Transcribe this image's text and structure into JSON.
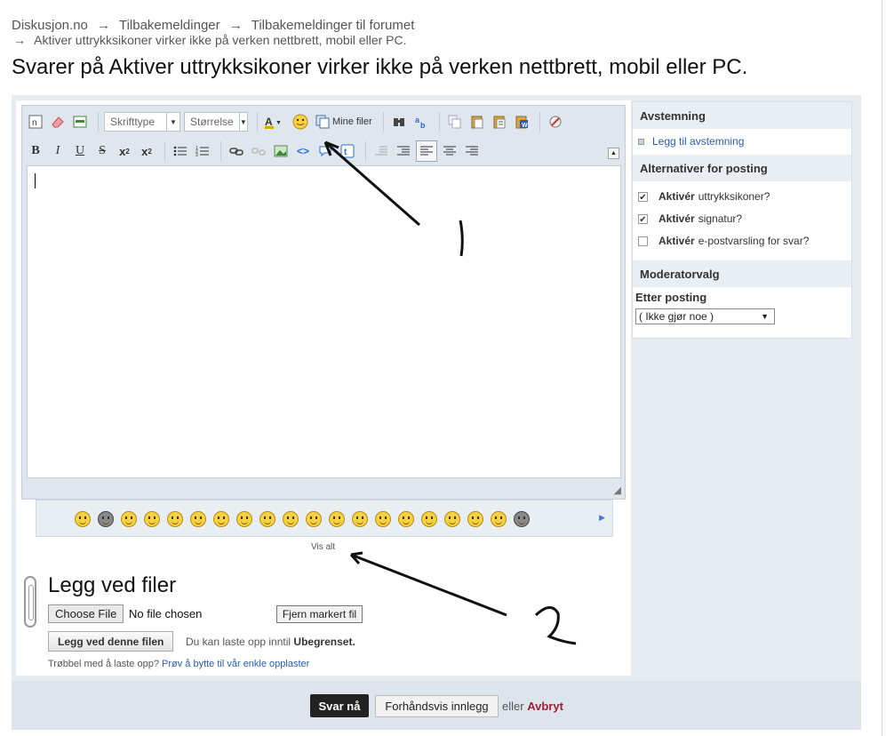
{
  "breadcrumb": {
    "items": [
      "Diskusjon.no",
      "Tilbakemeldinger",
      "Tilbakemeldinger til forumet"
    ],
    "current": "Aktiver uttrykksikoner virker ikke på verken nettbrett, mobil eller PC.",
    "separator": "→"
  },
  "page_title": "Svarer på Aktiver uttrykksikoner virker ikke på verken nettbrett, mobil eller PC.",
  "toolbar": {
    "font_select": "Skrifttype",
    "size_select": "Størrelse",
    "my_files": "Mine filer",
    "bold": "B",
    "italic": "I",
    "underline": "U",
    "strike": "S",
    "subscript": "x",
    "superscript": "x"
  },
  "smilies": {
    "view_all": "Vis alt",
    "count": 20
  },
  "attachments": {
    "heading": "Legg ved filer",
    "choose_file": "Choose File",
    "no_file": "No file chosen",
    "remove_selected": "Fjern markert fil",
    "upload_button": "Legg ved denne filen",
    "limit_prefix": "Du kan laste opp inntil",
    "limit_value": "Ubegrenset.",
    "trouble_text": "Trøbbel med å laste opp?",
    "trouble_link": "Prøv å bytte til vår enkle opplaster"
  },
  "sidebar": {
    "poll_heading": "Avstemning",
    "add_poll": "Legg til avstemning",
    "options_heading": "Alternativer for posting",
    "options": [
      {
        "bold": "Aktivér",
        "text": "uttrykksikoner?",
        "checked": true
      },
      {
        "bold": "Aktivér",
        "text": "signatur?",
        "checked": true
      },
      {
        "bold": "Aktivér",
        "text": "e-postvarsling for svar?",
        "checked": false
      }
    ],
    "moderator_heading": "Moderatorvalg",
    "after_posting_label": "Etter posting",
    "after_posting_value": "( Ikke gjør noe )"
  },
  "actions": {
    "submit": "Svar nå",
    "preview": "Forhåndsvis innlegg",
    "or": "eller",
    "cancel": "Avbryt"
  },
  "colors": {
    "frame_bg": "#e6ecf1",
    "submit_bg": "#222222",
    "link": "#2a5db0",
    "cancel": "#a0203a"
  }
}
